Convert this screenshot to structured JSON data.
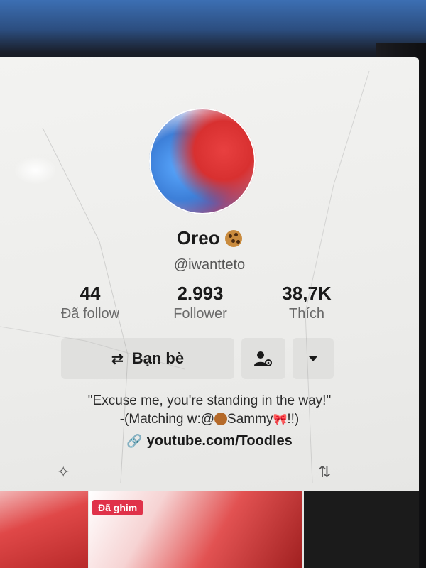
{
  "profile": {
    "display_name": "Oreo",
    "name_emoji_icon": "cookie-icon",
    "handle": "@iwantteto"
  },
  "stats": [
    {
      "value": "44",
      "label": "Đã follow"
    },
    {
      "value": "2.993",
      "label": "Follower"
    },
    {
      "value": "38,7K",
      "label": "Thích"
    }
  ],
  "actions": {
    "friends_label": "Bạn bè",
    "friends_icon": "swap-arrows-icon",
    "person_icon": "person-settings-icon",
    "more_icon": "chevron-down-icon"
  },
  "bio": {
    "line1": "\"Excuse me, you're standing in the way!\"",
    "line2_prefix": "-(Matching w:@",
    "line2_name": "Sammy",
    "line2_suffix": "!!)",
    "link": "youtube.com/Toodles"
  },
  "grid": {
    "pinned_label": "Đã ghim"
  },
  "colors": {
    "accent_pin": "#e0324a",
    "button_bg": "#e0e0de"
  }
}
